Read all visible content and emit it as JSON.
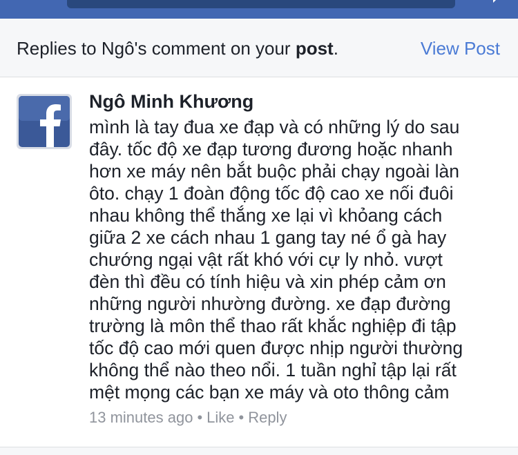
{
  "header": {
    "text_prefix": "Replies to Ngô's comment on your ",
    "text_bold": "post",
    "text_suffix": ".",
    "view_post": "View Post"
  },
  "comment": {
    "author": "Ngô Minh Khương",
    "lines": [
      "mình là tay đua xe đạp và có những lý do sau",
      "đây. tốc độ xe đạp tương đương hoặc nhanh",
      "hơn xe máy nên bắt buộc phải chạy ngoài làn",
      "ôto. chạy 1 đoàn động tốc độ cao xe nối đuôi",
      "nhau không thể thắng xe lại vì khỏang cách",
      "giữa 2 xe cách nhau 1 gang tay né ổ gà hay",
      "chướng ngại vật rất khó với cự ly nhỏ. vượt",
      "đèn thì đều có tính hiệu và xin phép cảm ơn",
      "những người nhường đường. xe đạp đường",
      "trường là môn thể thao rất khắc nghiệp đi tập",
      "tốc độ cao mới quen được nhịp người thường",
      "không thể nào theo nổi. 1 tuần nghỉ tập lại rất",
      "mệt mọng các bạn xe máy và oto thông cảm"
    ],
    "time": "13 minutes ago",
    "separator": "•",
    "like": "Like",
    "reply": "Reply"
  },
  "colors": {
    "facebook_blue": "#4267b2",
    "link_blue": "#4b7bd5",
    "meta_gray": "#90949c"
  },
  "icons": {
    "avatar": "facebook-logo-icon",
    "top_right": "messenger-icon"
  }
}
